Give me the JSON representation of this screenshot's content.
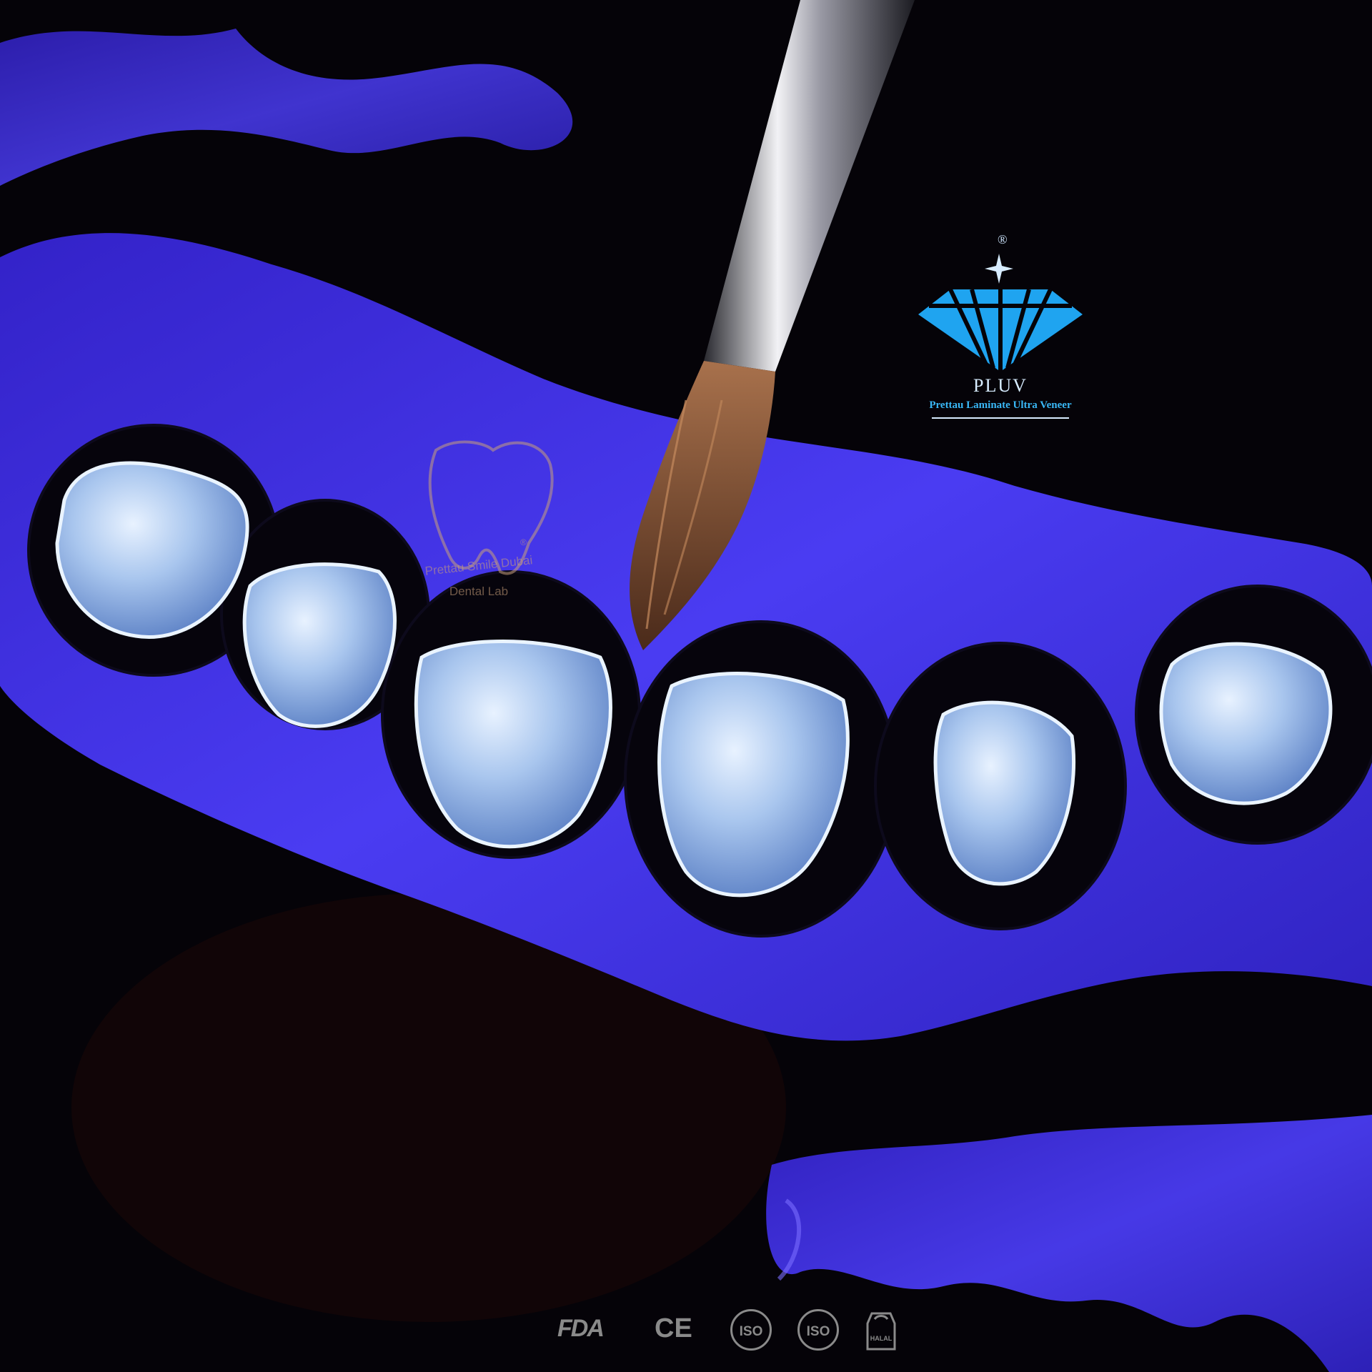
{
  "pluv_logo": {
    "registered_mark": "®",
    "brand": "PLUV",
    "tagline": "Prettau Laminate Ultra Veneer",
    "color": "#1fa4f0"
  },
  "lab_logo": {
    "name": "Prettau Smile Dubai",
    "subtitle": "Dental Lab",
    "registered_mark": "®",
    "color": "#c9a07a"
  },
  "certifications": {
    "fda": "FDA",
    "ce": "CE",
    "iso_1": "ISO",
    "iso_2": "ISO",
    "halal": "HALAL"
  },
  "colors": {
    "background": "#050308",
    "resin_blue": "#3b2fe0",
    "veneer": "#a9c6ee",
    "brush_bristle": "#7a4a2e"
  }
}
